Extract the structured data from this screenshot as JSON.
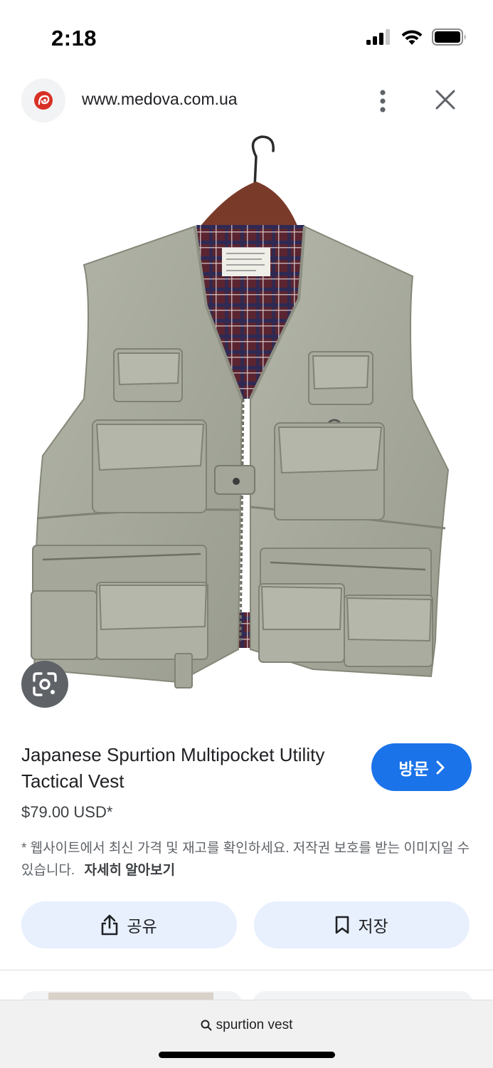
{
  "status_bar": {
    "time": "2:18",
    "icons": [
      "signal-icon",
      "wifi-icon",
      "battery-icon"
    ]
  },
  "header": {
    "site_logo_icon": "medova-logo",
    "url": "www.medova.com.ua",
    "more_icon": "more-vertical-icon",
    "close_icon": "close-icon"
  },
  "product": {
    "image_subject": "vest-photo",
    "lens_icon": "google-lens-icon",
    "title": "Japanese Spurtion Multipocket Utility Tactical Vest",
    "price": "$79.00 USD*",
    "disclaimer": "* 웹사이트에서 최신 가격 및 재고를 확인하세요. 저작권 보호를 받는 이미지일 수 있습니다.",
    "learn_more": "자세히 알아보기"
  },
  "visit_button": {
    "label": "방문",
    "icon": "chevron-right-icon"
  },
  "actions": {
    "share_label": "공유",
    "share_icon": "share-icon",
    "save_label": "저장",
    "save_icon": "bookmark-icon"
  },
  "search": {
    "query": "spurtion vest",
    "icon": "search-icon"
  },
  "colors": {
    "accent": "#1a73e8",
    "action_bg": "#e8f0fe",
    "vest": "#a9ac9e",
    "logo_red": "#d93025"
  }
}
